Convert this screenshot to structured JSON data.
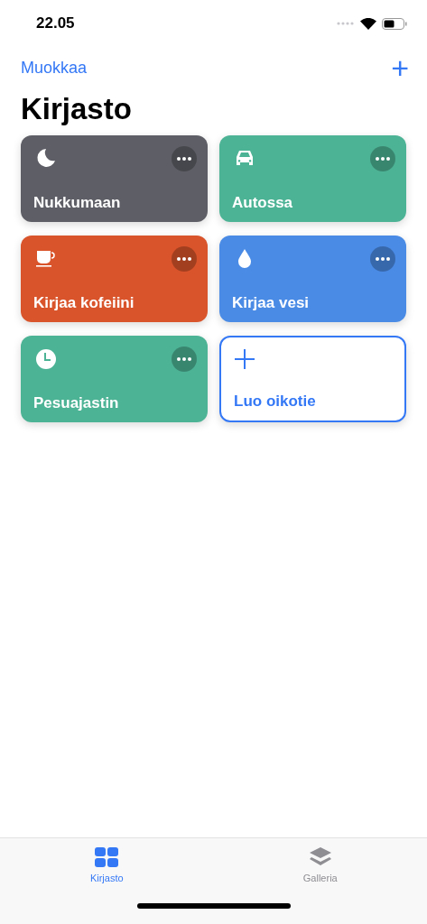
{
  "status_bar": {
    "time": "22.05"
  },
  "nav": {
    "edit": "Muokkaa",
    "add": "+"
  },
  "title": "Kirjasto",
  "cards": [
    {
      "kind": "shortcut",
      "label": "Nukkumaan",
      "color": "#5e5f66"
    },
    {
      "kind": "shortcut",
      "label": "Autossa",
      "color": "#4db395"
    },
    {
      "kind": "shortcut",
      "label": "Kirjaa kofeiini",
      "color": "#d9542a"
    },
    {
      "kind": "shortcut",
      "label": "Kirjaa vesi",
      "color": "#4a8be6"
    },
    {
      "kind": "shortcut",
      "label": "Pesuajastin",
      "color": "#4db395"
    },
    {
      "kind": "create",
      "label": "Luo oikotie"
    }
  ],
  "tab_bar": [
    {
      "label": "Kirjasto",
      "selected": true
    },
    {
      "label": "Galleria",
      "selected": false
    }
  ]
}
